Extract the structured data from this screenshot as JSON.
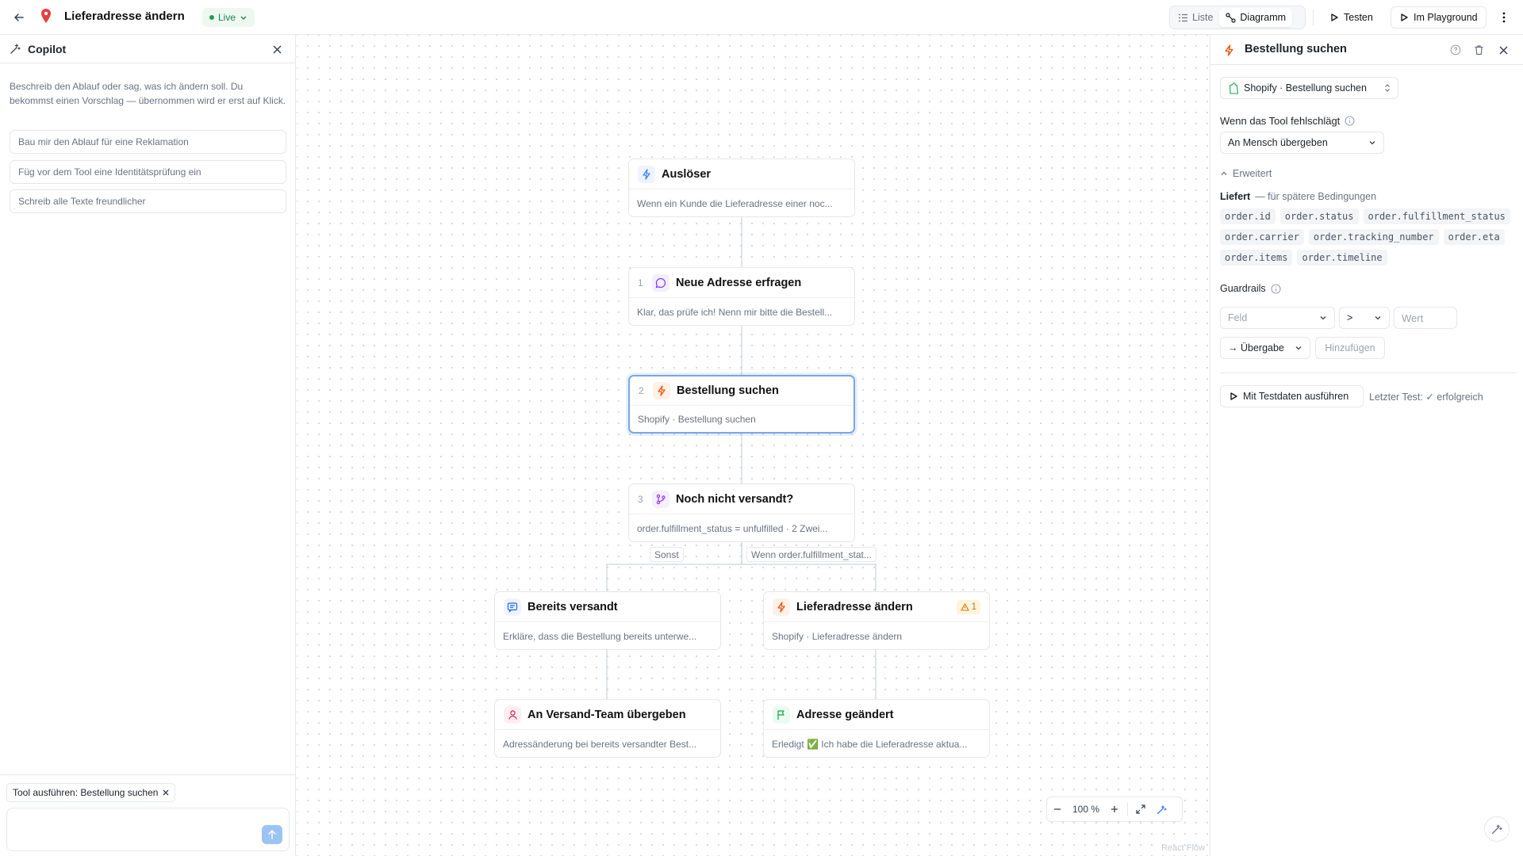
{
  "topbar": {
    "title": "Lieferadresse ändern",
    "status": "Live",
    "view_list": "Liste",
    "view_diagram": "Diagramm",
    "test_label": "Testen",
    "playground_label": "Im Playground"
  },
  "copilot": {
    "title": "Copilot",
    "description": "Beschreib den Ablauf oder sag, was ich ändern soll. Du bekommst einen Vorschlag — übernommen wird er erst auf Klick.",
    "suggestions": [
      "Bau mir den Ablauf für eine Reklamation",
      "Füg vor dem Tool eine Identitätsprüfung ein",
      "Schreib alle Texte freundlicher"
    ],
    "context_chip": "Tool ausführen: Bestellung suchen",
    "input_value": ""
  },
  "canvas": {
    "nodes": [
      {
        "num": "",
        "title": "Auslöser",
        "subtitle": "Wenn ein Kunde die Lieferadresse einer noc...",
        "icon": "bolt-icon"
      },
      {
        "num": "1",
        "title": "Neue Adresse erfragen",
        "subtitle": "Klar, das prüfe ich! Nenn mir bitte die Bestell...",
        "icon": "chat-icon"
      },
      {
        "num": "2",
        "title": "Bestellung suchen",
        "subtitle": "Shopify · Bestellung suchen",
        "icon": "bolt-icon"
      },
      {
        "num": "3",
        "title": "Noch nicht versandt?",
        "subtitle": "order.fulfillment_status = unfulfilled · 2 Zwei...",
        "icon": "branch-icon"
      },
      {
        "num": "",
        "title": "Bereits versandt",
        "subtitle": "Erkläre, dass die Bestellung bereits unterwe...",
        "icon": "message-icon"
      },
      {
        "num": "",
        "title": "Lieferadresse ändern",
        "subtitle": "Shopify · Lieferadresse ändern",
        "icon": "bolt-icon",
        "warning": "1"
      },
      {
        "num": "",
        "title": "An Versand-Team übergeben",
        "subtitle": "Adressänderung bei bereits versandter Best...",
        "icon": "person-icon"
      },
      {
        "num": "",
        "title": "Adresse geändert",
        "subtitle": "Erledigt ✅ Ich habe die Lieferadresse aktua...",
        "icon": "flag-icon"
      }
    ],
    "edge_labels": {
      "else": "Sonst",
      "if": "Wenn order.fulfillment_stat..."
    },
    "zoom": "100 %",
    "attribution": "React Flow"
  },
  "panel": {
    "title": "Bestellung suchen",
    "tool": "Shopify · Bestellung suchen",
    "on_fail_label": "Wenn das Tool fehlschlägt",
    "on_fail_value": "An Mensch übergeben",
    "advanced_label": "Erweitert",
    "provides_label": "Liefert",
    "provides_hint": "— für spätere Bedingungen",
    "fields": [
      "order.id",
      "order.status",
      "order.fulfillment_status",
      "order.carrier",
      "order.tracking_number",
      "order.eta",
      "order.items",
      "order.timeline"
    ],
    "guardrails_label": "Guardrails",
    "guard_field_placeholder": "Feld",
    "guard_operator": ">",
    "guard_value_placeholder": "Wert",
    "guard_action": "→ Übergabe",
    "add_label": "Hinzufügen",
    "run_label": "Mit Testdaten ausführen",
    "last_test": "Letzter Test: ✓ erfolgreich"
  },
  "colors": {
    "accent": "#3b82f6",
    "live": "#1f9d55",
    "tool": "#ea580c",
    "warning": "#d97706"
  }
}
